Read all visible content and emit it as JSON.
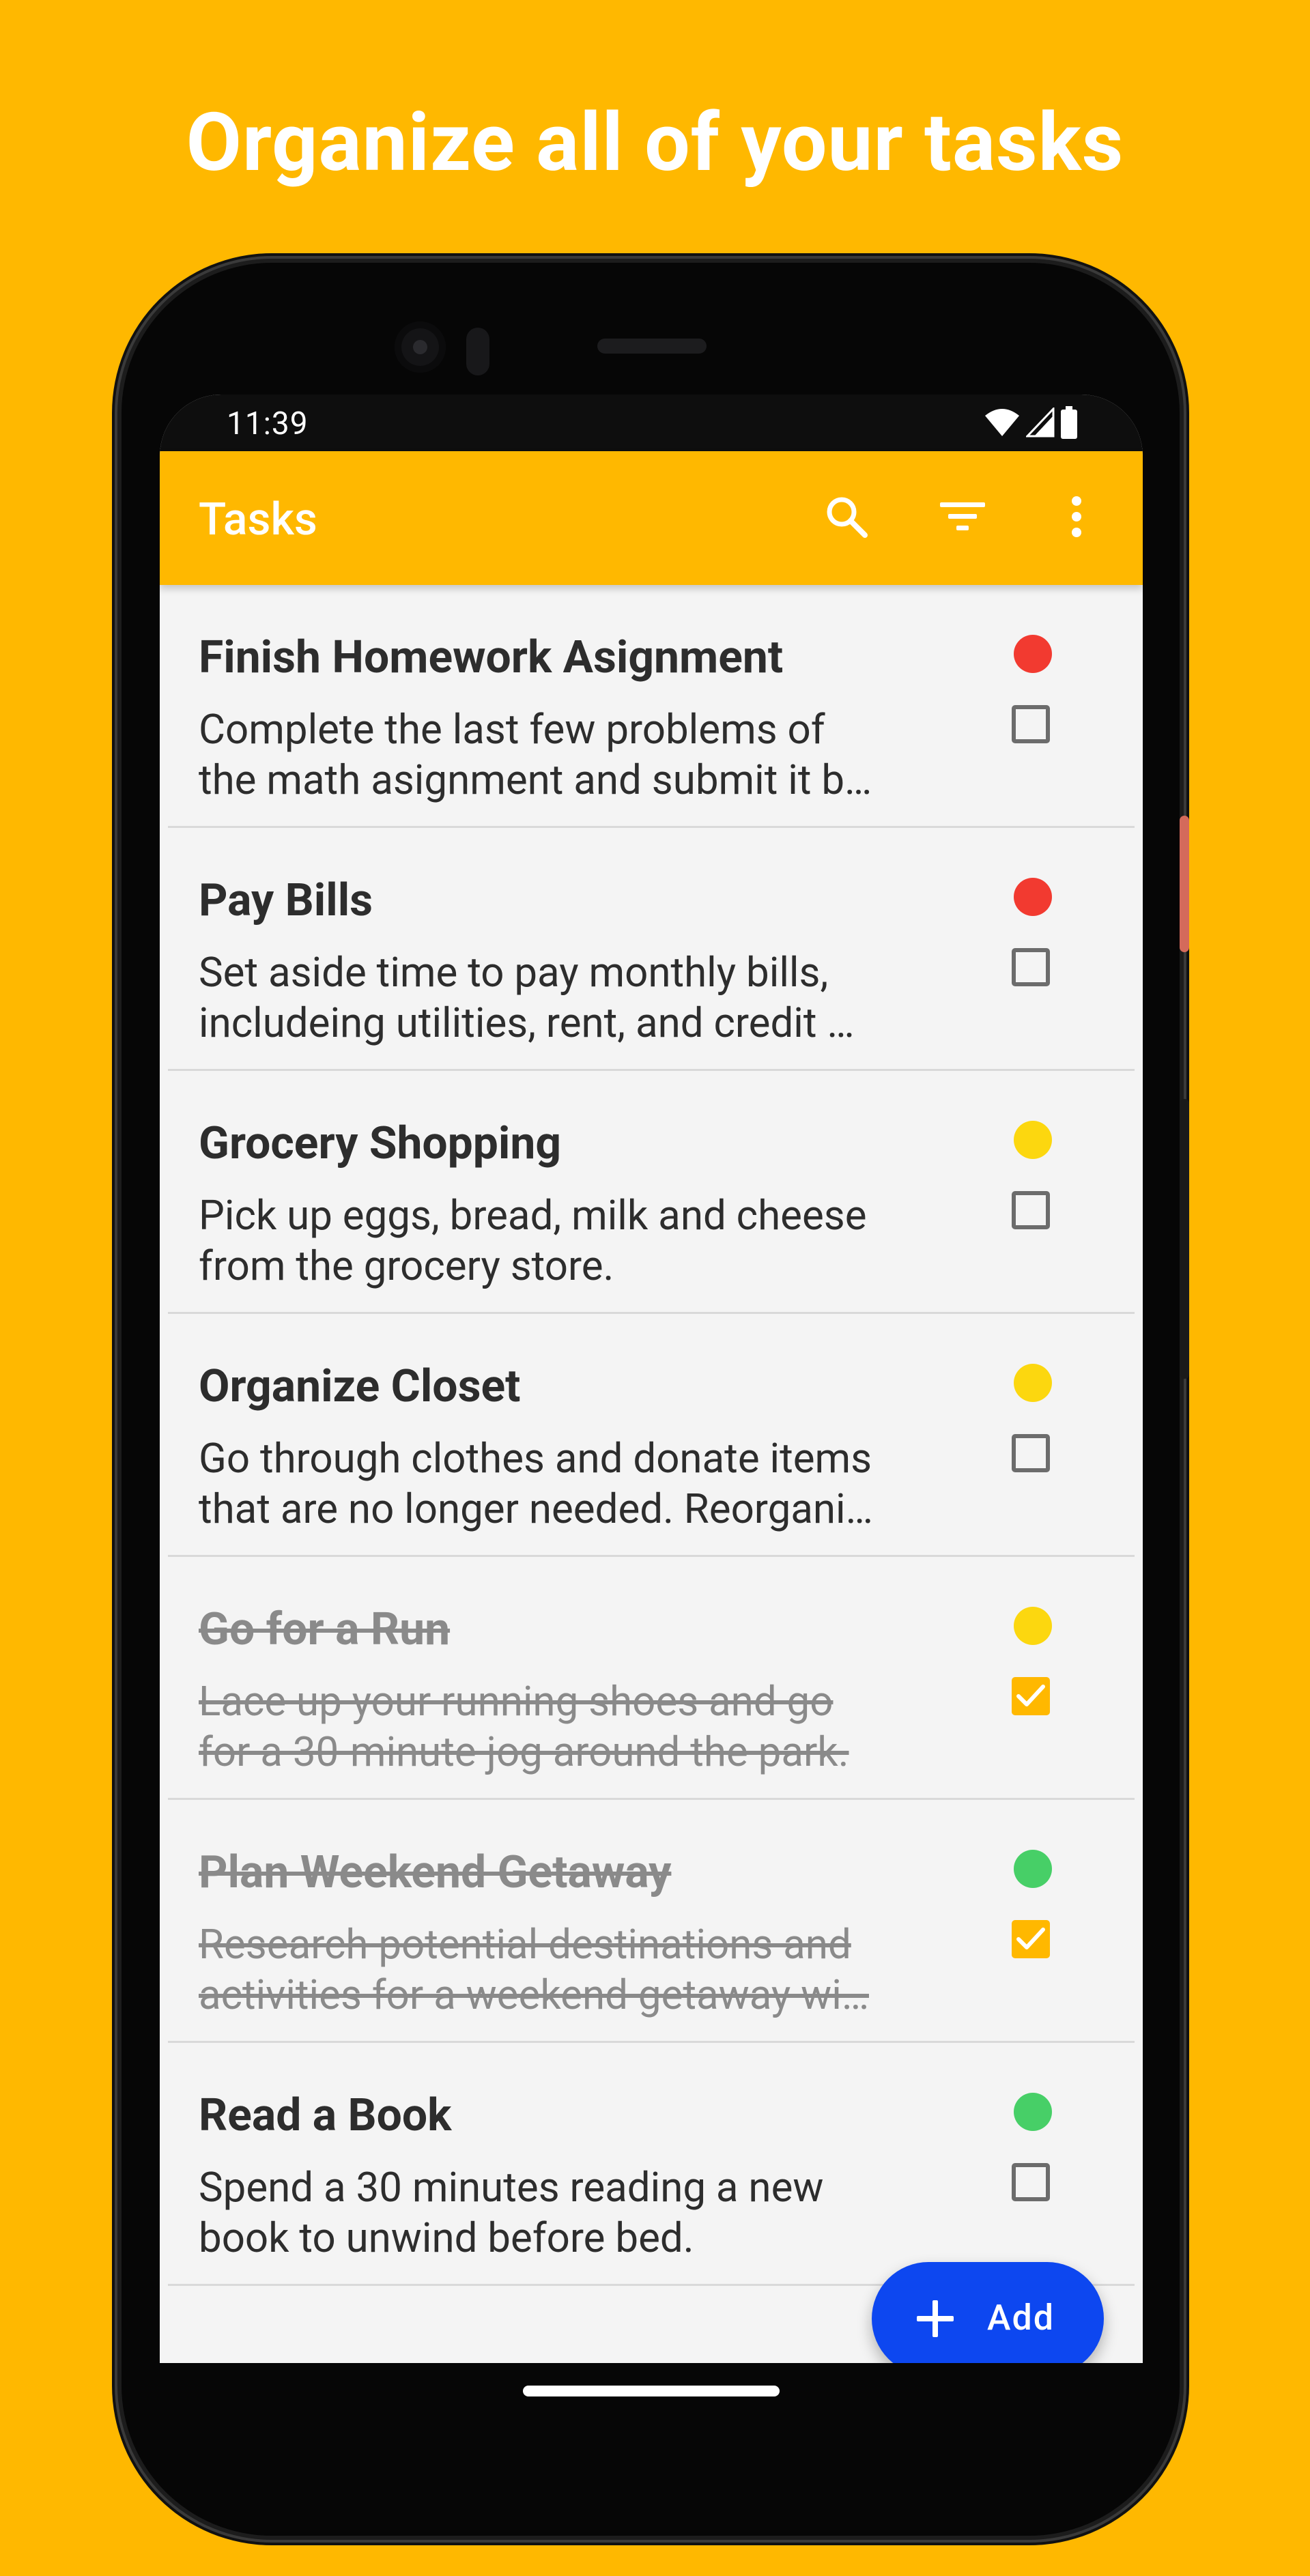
{
  "headline": "Organize all of your tasks",
  "status_bar": {
    "time": "11:39",
    "icons": [
      "wifi-icon",
      "cellular-signal-icon",
      "battery-icon"
    ]
  },
  "app_bar": {
    "title": "Tasks",
    "actions": [
      "search-icon",
      "filter-icon",
      "more-vert-icon"
    ]
  },
  "colors": {
    "brand": "#FFB800",
    "fab": "#0D47F0",
    "priority_high": "#F23A30",
    "priority_medium": "#FCD70F",
    "priority_low": "#47CF67"
  },
  "tasks": [
    {
      "title": "Finish Homework Asignment",
      "description_lines": [
        "Complete the last few problems of",
        "the math asignment and submit it b…"
      ],
      "priority": "high",
      "completed": false
    },
    {
      "title": "Pay Bills",
      "description_lines": [
        "Set aside time to pay monthly bills,",
        "includeing utilities, rent, and credit …"
      ],
      "priority": "high",
      "completed": false
    },
    {
      "title": "Grocery Shopping",
      "description_lines": [
        "Pick up eggs, bread, milk and cheese",
        "from the grocery store."
      ],
      "priority": "medium",
      "completed": false
    },
    {
      "title": "Organize Closet",
      "description_lines": [
        "Go through clothes and donate items",
        "that are no longer needed. Reorgani…"
      ],
      "priority": "medium",
      "completed": false
    },
    {
      "title": "Go for a Run",
      "description_lines": [
        "Lace up your running shoes and go",
        "for a 30-minute jog around the park."
      ],
      "priority": "medium",
      "completed": true
    },
    {
      "title": "Plan Weekend Getaway",
      "description_lines": [
        "Research potential destinations and",
        "activities for a weekend getaway wi…"
      ],
      "priority": "low",
      "completed": true
    },
    {
      "title": "Read a Book",
      "description_lines": [
        "Spend a 30 minutes reading a new",
        "book to unwind before bed."
      ],
      "priority": "low",
      "completed": false
    }
  ],
  "fab": {
    "label": "Add",
    "icon": "plus-icon"
  }
}
